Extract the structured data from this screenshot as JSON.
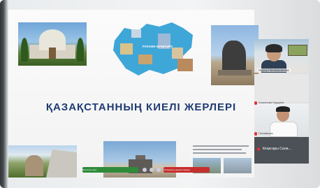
{
  "slide": {
    "title": "ҚАЗАҚСТАННЫҢ КИЕЛІ ЖЕРЛЕРІ",
    "map_label": "РУХАНИ ЖАҢҒЫРУ"
  },
  "participants": [
    {
      "name": "Нурсул Бекмаханова"
    },
    {
      "name": "Алшанова Нурдана"
    },
    {
      "name": "Галимкызы"
    },
    {
      "name": "Кеңесары Сали..."
    }
  ],
  "controls": {
    "audio_label": "Включить звук",
    "video_label": "Остановить демонстрацию"
  },
  "colors": {
    "title": "#1f3b73",
    "audio_button": "#2e8b3a",
    "video_button": "#c62f2f"
  }
}
